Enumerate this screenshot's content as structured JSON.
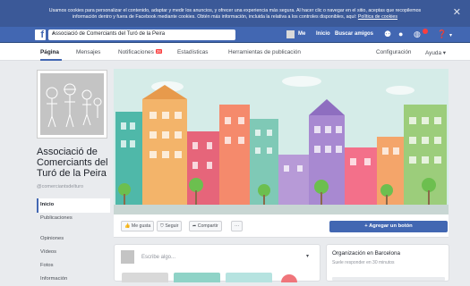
{
  "cookie_banner": {
    "line1": "Usamos cookies para personalizar el contenido, adaptar y medir los anuncios, y ofrecer una experiencia más segura. Al hacer clic o navegar en el sitio, aceptas que recopilemos",
    "line2": "información dentro y fuera de Facebook mediante cookies. Obtén más información, incluida la relativa a los controles disponibles, aquí:",
    "link": "Política de cookies",
    "close_icon": "close-icon"
  },
  "topbar": {
    "logo": "f",
    "search_value": "Associació de Comerciants del Turó de la Peira",
    "nav": [
      "Me",
      "Inicio",
      "Buscar amigos"
    ],
    "icons": [
      "friends-icon",
      "messenger-icon",
      "globe-icon",
      "help-icon"
    ],
    "colors": {
      "brand": "#4267b2",
      "banner": "#3b5998",
      "notification": "#fa3e3e"
    }
  },
  "tabs": {
    "items": [
      "Página",
      "Mensajes",
      "Notificaciones",
      "Estadísticas",
      "Herramientas de publicación"
    ],
    "notifications_badge": "28",
    "settings": "Configuración",
    "help": "Ayuda ▾"
  },
  "page": {
    "name": "Associació de Comerciants del Turó de la Peira",
    "handle": "@comerciantsdelturo",
    "menu": [
      "Inicio",
      "Publicaciones",
      "Opiniones",
      "Vídeos",
      "Fotos",
      "Información"
    ]
  },
  "actions": {
    "like": "Me gusta",
    "follow": "Seguir",
    "share": "Compartir",
    "more": "···",
    "cta": "+ Agregar un botón"
  },
  "composer": {
    "placeholder": "Escribe algo...",
    "caret": "▾"
  },
  "info_card": {
    "title": "Organización en Barcelona",
    "subtitle": "Suele responder en 30 minutos"
  }
}
